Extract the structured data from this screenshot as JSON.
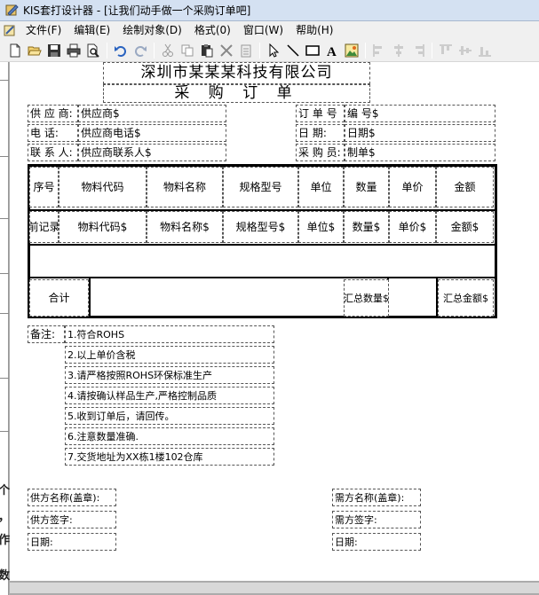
{
  "window": {
    "title": "KIS套打设计器 - [让我们动手做一个采购订单吧]"
  },
  "menu": [
    "文件(F)",
    "编辑(E)",
    "绘制对象(D)",
    "格式(0)",
    "窗口(W)",
    "帮助(H)"
  ],
  "toolbar": {
    "buttons": [
      "new-icon",
      "open-icon",
      "save-icon",
      "print-icon",
      "print-preview-icon",
      "undo-icon",
      "redo-icon",
      "cut-icon",
      "copy-icon",
      "paste-icon",
      "delete-icon",
      "clipboard-icon",
      "pointer-icon",
      "line-icon",
      "rectangle-icon",
      "text-icon",
      "image-icon",
      "align-left-icon",
      "align-center-icon",
      "align-right-icon",
      "align-top-icon",
      "align-middle-icon",
      "align-bottom-icon"
    ]
  },
  "document": {
    "company": "深圳市某某某科技有限公司",
    "form_title": "采 购 订 单",
    "labels": {
      "supplier": "供 应 商:",
      "phone": "电      话:",
      "contact": "联 系 人:",
      "order_no": "订 单 号",
      "date": "日      期:",
      "buyer": "采 购 员:"
    },
    "values": {
      "supplier": "供应商$",
      "phone": "供应商电话$",
      "contact": "供应商联系人$",
      "order_no": "编      号$",
      "date": "日期$",
      "buyer": "制单$"
    },
    "table": {
      "headers": [
        "序号",
        "物料代码",
        "物料名称",
        "规格型号",
        "单位",
        "数量",
        "单价",
        "金额"
      ],
      "row_fields": [
        "前记录",
        "物料代码$",
        "物料名称$",
        "规格型号$",
        "单位$",
        "数量$",
        "单价$",
        "金额$"
      ],
      "total_label": "合计",
      "total_qty": "汇总数量$",
      "total_amount": "汇总金额$"
    },
    "remarks_label": "备注:",
    "remarks": [
      "1.符合ROHS",
      "2.以上单价含税",
      "3.请严格按照ROHS环保标准生产",
      "4.请按确认样品生产,严格控制品质",
      "5.收到订单后，请回传。",
      "6.注意数量准确.",
      "7.交货地址为XX栋1楼102仓库"
    ],
    "signatures": {
      "supplier_name": "供方名称(盖章):",
      "supplier_sign": "供方签字:",
      "supplier_date": "日期:",
      "buyer_name": "需方名称(盖章):",
      "buyer_sign": "需方签字:",
      "buyer_date": "日期:"
    }
  },
  "side_glyphs": [
    "个",
    "，",
    "作",
    "数"
  ]
}
